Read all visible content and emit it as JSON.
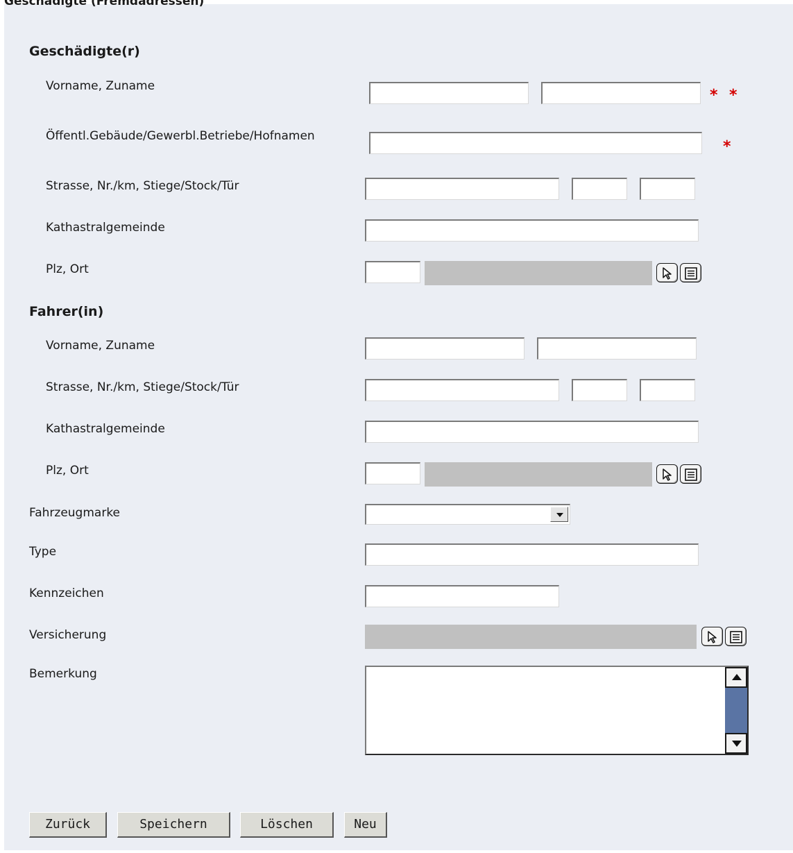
{
  "page": {
    "title": "Geschädigte (Fremdadressen)"
  },
  "geschaedigte": {
    "heading": "Geschädigte(r)",
    "name_label": "Vorname, Zuname",
    "gebaeude_label": "Öffentl.Gebäude/Gewerbl.Betriebe/Hofnamen",
    "strasse_label": "Strasse, Nr./km, Stiege/Stock/Tür",
    "kg_label": "Kathastralgemeinde",
    "plz_label": "Plz, Ort",
    "required_mark": "*"
  },
  "fahrer": {
    "heading": "Fahrer(in)",
    "name_label": "Vorname, Zuname",
    "strasse_label": "Strasse, Nr./km, Stiege/Stock/Tür",
    "kg_label": "Kathastralgemeinde",
    "plz_label": "Plz, Ort"
  },
  "fahrzeug": {
    "marke_label": "Fahrzeugmarke",
    "marke_value": "",
    "type_label": "Type",
    "kennzeichen_label": "Kennzeichen",
    "versicherung_label": "Versicherung",
    "bemerkung_label": "Bemerkung"
  },
  "buttons": {
    "back": "Zurück",
    "save": "Speichern",
    "delete": "Löschen",
    "new": "Neu"
  },
  "icons": {
    "select": "cursor-select-icon",
    "list": "list-icon"
  },
  "colors": {
    "panel_bg": "#ebeef4",
    "readonly_bg": "#c0c0c0",
    "required": "#d40000",
    "scroll_track": "#5a74a4",
    "button_bg": "#dcdcd6"
  }
}
